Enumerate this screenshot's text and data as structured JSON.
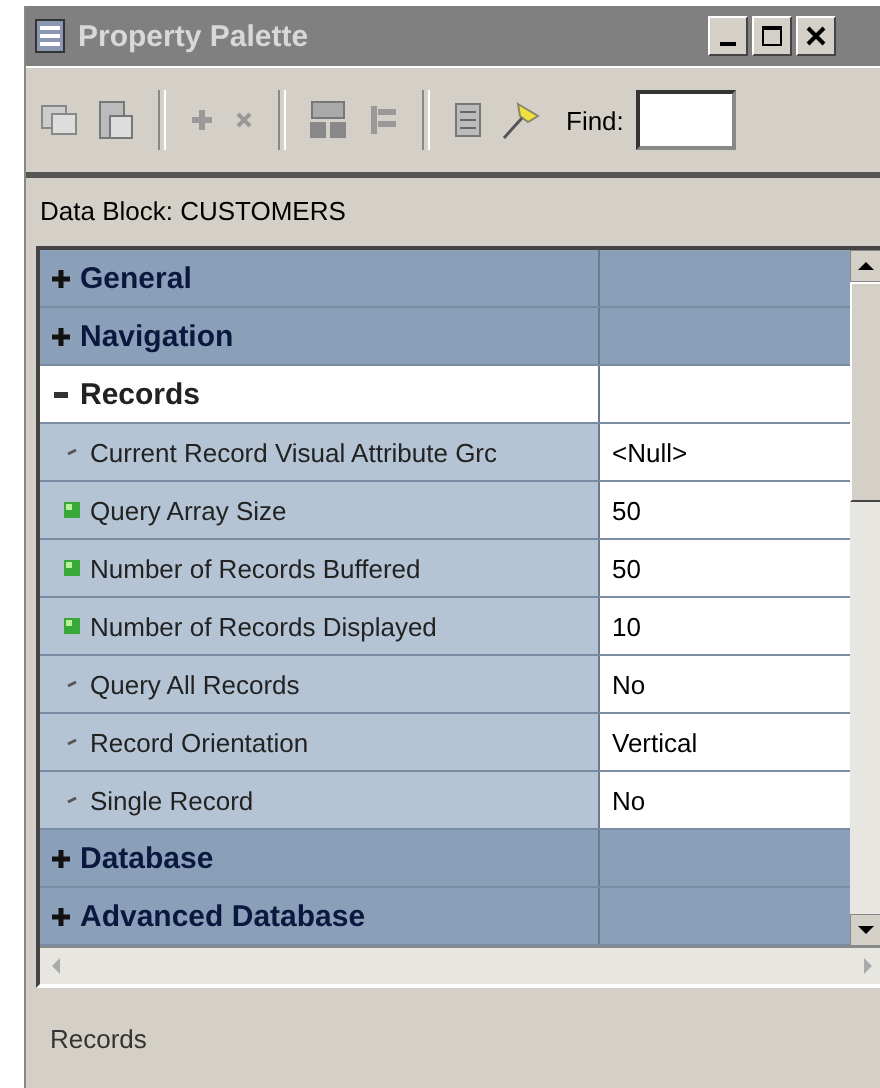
{
  "window": {
    "title": "Property Palette"
  },
  "toolbar": {
    "find_label": "Find:"
  },
  "context": "Data Block: CUSTOMERS",
  "sections": [
    {
      "name": "General",
      "expanded": false,
      "selected": false
    },
    {
      "name": "Navigation",
      "expanded": false,
      "selected": false
    },
    {
      "name": "Records",
      "expanded": true,
      "selected": true,
      "properties": [
        {
          "name": "Current Record Visual Attribute Grc",
          "value": "<Null>",
          "kind": "default"
        },
        {
          "name": "Query Array Size",
          "value": "50",
          "kind": "changed"
        },
        {
          "name": "Number of Records Buffered",
          "value": "50",
          "kind": "changed"
        },
        {
          "name": "Number of Records Displayed",
          "value": "10",
          "kind": "changed"
        },
        {
          "name": "Query All Records",
          "value": "No",
          "kind": "default"
        },
        {
          "name": "Record Orientation",
          "value": "Vertical",
          "kind": "default"
        },
        {
          "name": "Single Record",
          "value": "No",
          "kind": "default"
        }
      ]
    },
    {
      "name": "Database",
      "expanded": false,
      "selected": false
    },
    {
      "name": "Advanced Database",
      "expanded": false,
      "selected": false
    }
  ],
  "status_bar": "Records"
}
